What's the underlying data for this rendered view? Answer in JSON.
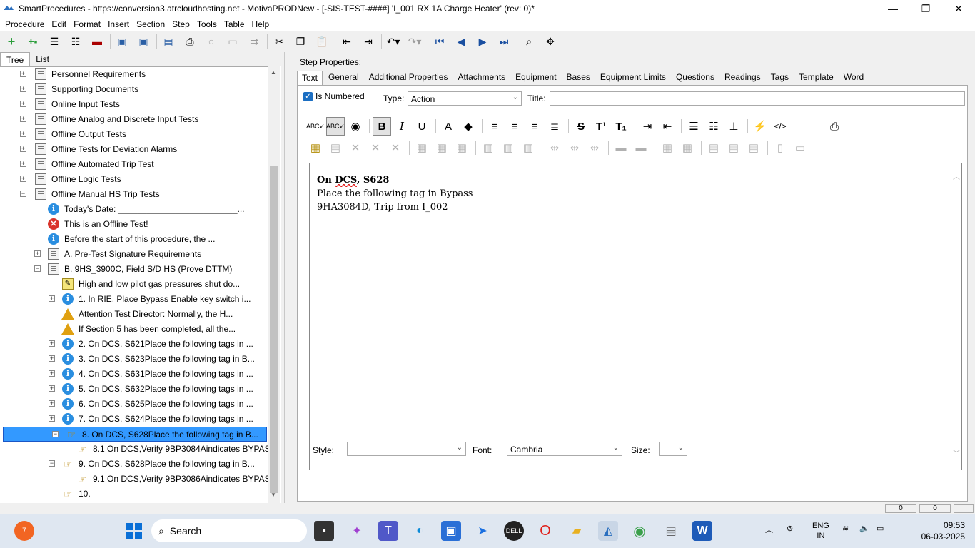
{
  "window": {
    "title": "SmartProcedures - https://conversion3.atrcloudhosting.net - MotivaPRODNew - [-SIS-TEST-####] 'I_001 RX 1A Charge Heater' (rev: 0)*",
    "minimize": "—",
    "maximize": "❐",
    "close": "✕"
  },
  "menu": [
    "Procedure",
    "Edit",
    "Format",
    "Insert",
    "Section",
    "Step",
    "Tools",
    "Table",
    "Help"
  ],
  "left_tabs": {
    "tree": "Tree",
    "list": "List"
  },
  "tree": [
    {
      "label": "Personnel Requirements",
      "level": 0,
      "icon": "doc",
      "expander": "+"
    },
    {
      "label": "Supporting Documents",
      "level": 0,
      "icon": "doc",
      "expander": "+"
    },
    {
      "label": "Online Input Tests",
      "level": 0,
      "icon": "doc",
      "expander": "+"
    },
    {
      "label": "Offline Analog and Discrete Input Tests",
      "level": 0,
      "icon": "doc",
      "expander": "+"
    },
    {
      "label": "Offline Output Tests",
      "level": 0,
      "icon": "doc",
      "expander": "+"
    },
    {
      "label": "Offline Tests for Deviation Alarms",
      "level": 0,
      "icon": "doc",
      "expander": "+"
    },
    {
      "label": "Offline Automated Trip Test",
      "level": 0,
      "icon": "doc",
      "expander": "+"
    },
    {
      "label": "Offline Logic Tests",
      "level": 0,
      "icon": "doc",
      "expander": "+"
    },
    {
      "label": "Offline Manual HS Trip Tests",
      "level": 0,
      "icon": "doc",
      "expander": "−"
    },
    {
      "label": "Today's Date: _________________________...",
      "level": 1,
      "icon": "info",
      "expander": ""
    },
    {
      "label": "This is an Offline Test!",
      "level": 1,
      "icon": "error",
      "expander": ""
    },
    {
      "label": "Before the start of this procedure, the ...",
      "level": 1,
      "icon": "info",
      "expander": ""
    },
    {
      "label": "A. Pre-Test Signature Requirements",
      "level": 1,
      "icon": "doc",
      "expander": "+"
    },
    {
      "label": "B. 9HS_3900C, Field S/D HS (Prove DTTM)",
      "level": 1,
      "icon": "doc",
      "expander": "−"
    },
    {
      "label": "High and low pilot gas pressures shut do...",
      "level": 2,
      "icon": "note",
      "expander": ""
    },
    {
      "label": "1. In RIE, Place Bypass Enable key switch i...",
      "level": 2,
      "icon": "info",
      "expander": "+"
    },
    {
      "label": "Attention Test Director: Normally, the H...",
      "level": 2,
      "icon": "warn",
      "expander": ""
    },
    {
      "label": "If Section 5 has been completed, all the...",
      "level": 2,
      "icon": "warn",
      "expander": ""
    },
    {
      "label": "2. On DCS, S621Place the following tags in ...",
      "level": 2,
      "icon": "info",
      "expander": "+"
    },
    {
      "label": "3. On DCS, S623Place the following tag in B...",
      "level": 2,
      "icon": "info",
      "expander": "+"
    },
    {
      "label": "4. On DCS, S631Place the following tags in ...",
      "level": 2,
      "icon": "info",
      "expander": "+"
    },
    {
      "label": "5. On DCS, S632Place the following tags in ...",
      "level": 2,
      "icon": "info",
      "expander": "+"
    },
    {
      "label": "6. On DCS, S625Place the following tags in ...",
      "level": 2,
      "icon": "info",
      "expander": "+"
    },
    {
      "label": "7. On DCS, S624Place the following tags in ...",
      "level": 2,
      "icon": "info",
      "expander": "+"
    },
    {
      "label": "8. On DCS, S628Place the following tag in B...",
      "level": 2,
      "icon": "hand",
      "expander": "−",
      "selected": true
    },
    {
      "label": "8.1 On DCS,Verify 9BP3084Aindicates BYPASS",
      "level": 3,
      "icon": "hand",
      "expander": ""
    },
    {
      "label": "9. On DCS, S628Place the following tag in B...",
      "level": 2,
      "icon": "hand",
      "expander": "−"
    },
    {
      "label": "9.1 On DCS,Verify 9BP3086Aindicates BYPASS",
      "level": 3,
      "icon": "hand",
      "expander": ""
    },
    {
      "label": "10.",
      "level": 2,
      "icon": "hand",
      "expander": ""
    }
  ],
  "step_properties": {
    "heading": "Step Properties:",
    "tabs": [
      "Text",
      "General",
      "Additional Properties",
      "Attachments",
      "Equipment",
      "Bases",
      "Equipment Limits",
      "Questions",
      "Readings",
      "Tags",
      "Template",
      "Word"
    ],
    "is_numbered_label": "Is Numbered",
    "is_numbered": true,
    "type_label": "Type:",
    "type_value": "Action",
    "title_label": "Title:",
    "title_value": ""
  },
  "editor": {
    "line1_a": "On ",
    "line1_b": "DCS",
    "line1_c": ", S628",
    "line2": "Place the following tag in Bypass",
    "line3": "9HA3084D, Trip from I_002"
  },
  "style_row": {
    "style_label": "Style:",
    "style_value": "",
    "font_label": "Font:",
    "font_value": "Cambria",
    "size_label": "Size:",
    "size_value": ""
  },
  "statusbar": {
    "box1": "0",
    "box2": "0"
  },
  "taskbar": {
    "search_placeholder": "Search",
    "notification_count": "7",
    "lang": "ENG",
    "region": "IN",
    "time": "09:53",
    "date": "06-03-2025"
  },
  "colors": {
    "selection": "#3399ff",
    "info_icon": "#2a8ee0",
    "error_icon": "#d9342b",
    "warn_icon": "#e0a010",
    "checkbox": "#1b6ec2"
  }
}
